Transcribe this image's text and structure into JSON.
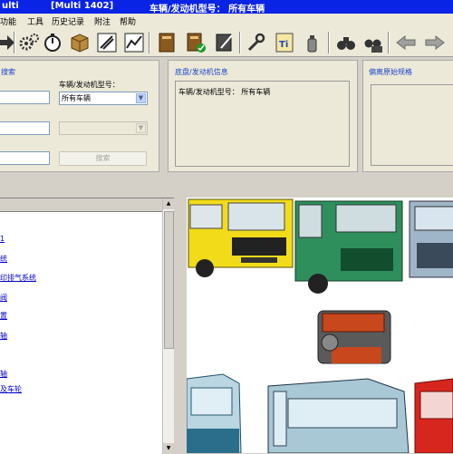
{
  "titlebar": {
    "app_fragment": "ulti",
    "window_tag": "[Multi 1402]",
    "context": "车辆/发动机型号： 所有车辆"
  },
  "menu": [
    "功能",
    "工具",
    "历史记录",
    "附注",
    "帮助"
  ],
  "toolbar": {
    "icons": [
      "arrow-icon",
      "gears-icon",
      "stopwatch-icon",
      "package-icon",
      "wrench-tool-icon",
      "chart-icon",
      "book-icon",
      "book-check-icon",
      "notepad-edit-icon",
      "wrench-icon",
      "ti-icon",
      "spray-can-icon",
      "binoculars-icon",
      "binoculars-folder-icon",
      "back-arrow-icon",
      "forward-arrow-icon"
    ]
  },
  "search_panel": {
    "title": "搜索",
    "vehicle_label": "车辆/发动机型号：",
    "vehicle_select_value": "所有车辆",
    "search_button": "搜索"
  },
  "chassis_panel": {
    "title": "底盘/发动机信息",
    "content": "车辆/发动机型号： 所有车辆"
  },
  "spec_panel": {
    "title": "偏离原始规格"
  },
  "tree": {
    "items": [
      "1",
      "统",
      "印排气系统",
      "阀",
      "置",
      "轴",
      "轴",
      "及车轮"
    ]
  }
}
